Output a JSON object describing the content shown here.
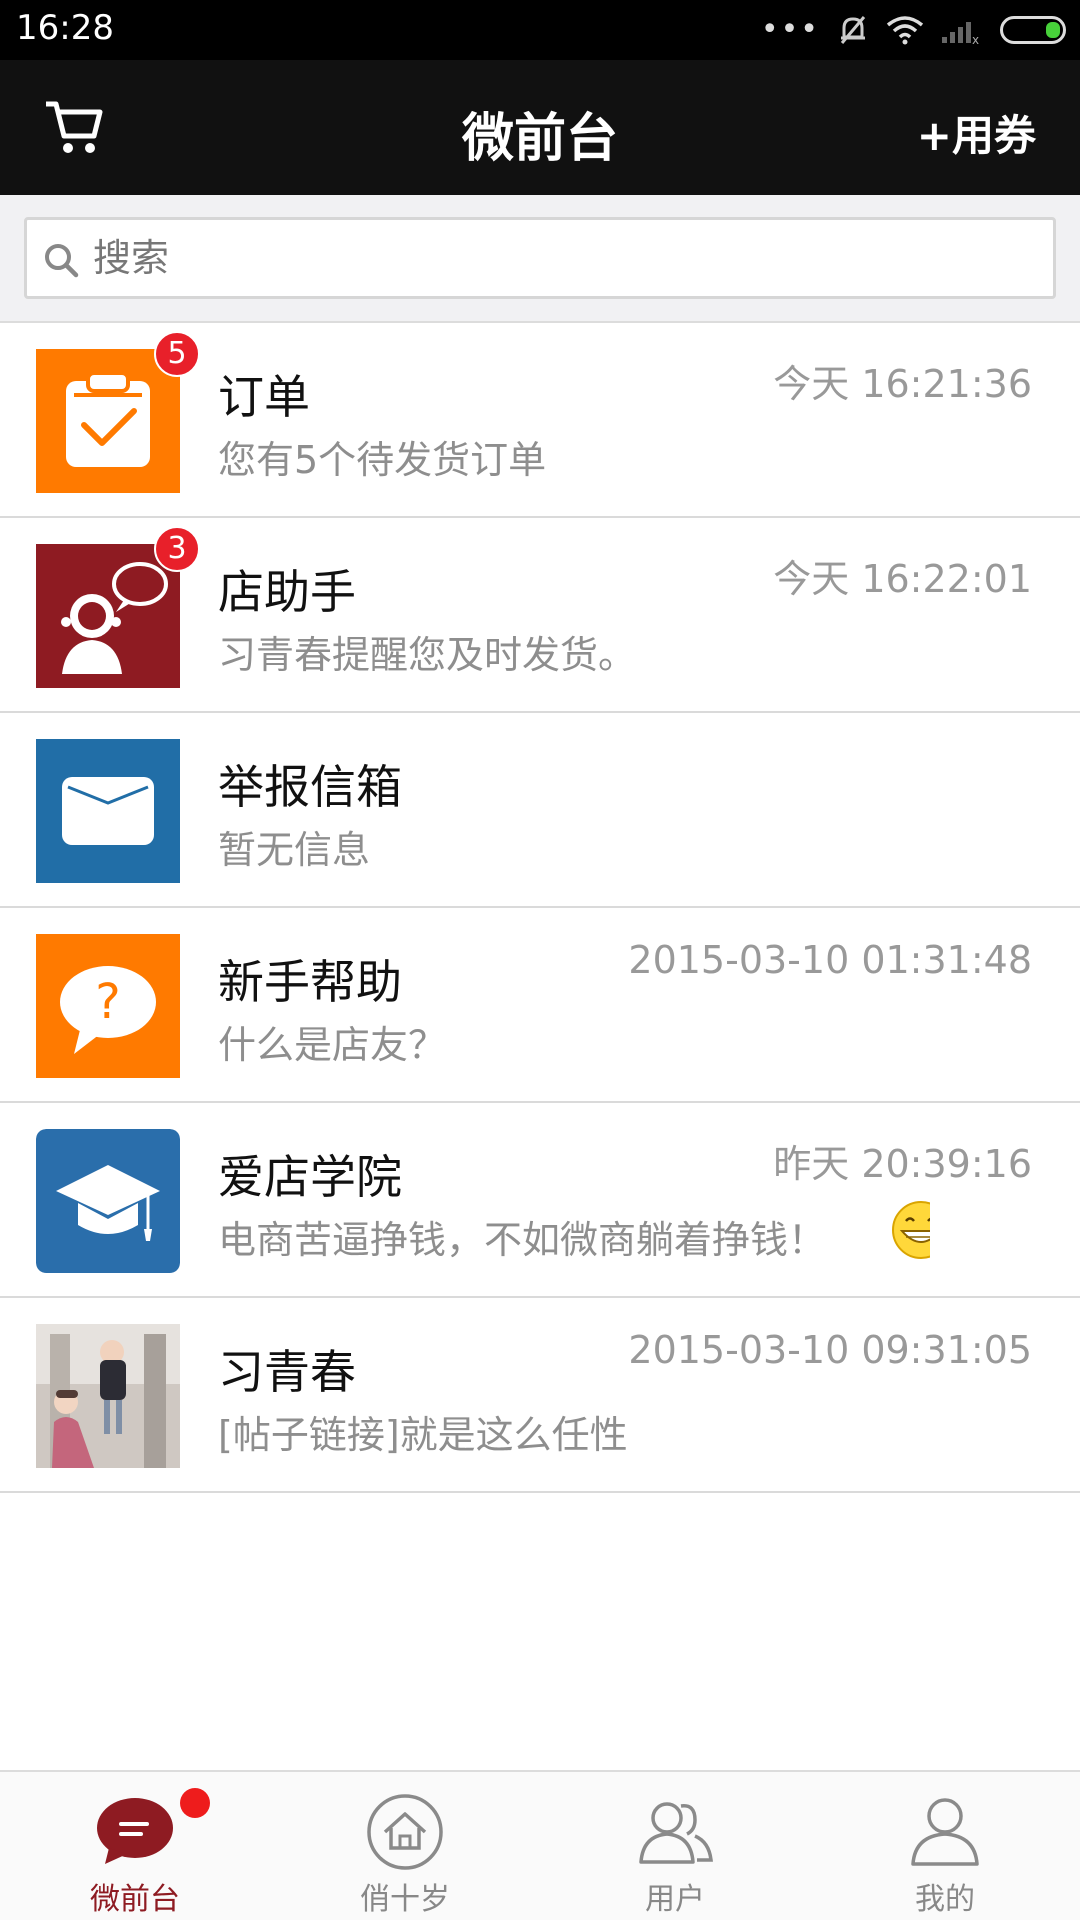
{
  "status_bar": {
    "time": "16:28",
    "dots": "•••"
  },
  "nav": {
    "title": "微前台",
    "coupon_label": "+用券",
    "cart_icon": "cart-icon"
  },
  "search": {
    "placeholder": "搜索",
    "icon": "search-icon"
  },
  "messages": [
    {
      "title": "订单",
      "time": "今天 16:21:36",
      "subtitle": "您有5个待发货订单",
      "badge": "5",
      "icon": "clipboard-check-icon",
      "color": "#ff7a00"
    },
    {
      "title": "店助手",
      "time": "今天 16:22:01",
      "subtitle": "习青春提醒您及时发货。",
      "badge": "3",
      "icon": "assistant-icon",
      "color": "#8e1b22"
    },
    {
      "title": "举报信箱",
      "time": "",
      "subtitle": "暂无信息",
      "badge": "",
      "icon": "envelope-icon",
      "color": "#216ea7"
    },
    {
      "title": "新手帮助",
      "time": "2015-03-10 01:31:48",
      "subtitle": "什么是店友？",
      "badge": "",
      "icon": "question-bubble-icon",
      "color": "#ff7a00"
    },
    {
      "title": "爱店学院",
      "time": "昨天 20:39:16",
      "subtitle": "电商苦逼挣钱，不如微商躺着挣钱！",
      "badge": "",
      "icon": "graduation-cap-icon",
      "color": "#2a6eab"
    },
    {
      "title": "习青春",
      "time": "2015-03-10 09:31:05",
      "subtitle": "[帖子链接]就是这么任性",
      "badge": "",
      "icon": "photo-avatar",
      "color": ""
    }
  ],
  "tabs": [
    {
      "label": "微前台",
      "icon": "chat-bubble-icon",
      "active": true
    },
    {
      "label": "俏十岁",
      "icon": "home-icon",
      "active": false
    },
    {
      "label": "用户",
      "icon": "users-icon",
      "active": false
    },
    {
      "label": "我的",
      "icon": "person-icon",
      "active": false
    }
  ],
  "colors": {
    "navbar": "#111111",
    "accent": "#8e1b22",
    "badge": "#e8202a"
  }
}
